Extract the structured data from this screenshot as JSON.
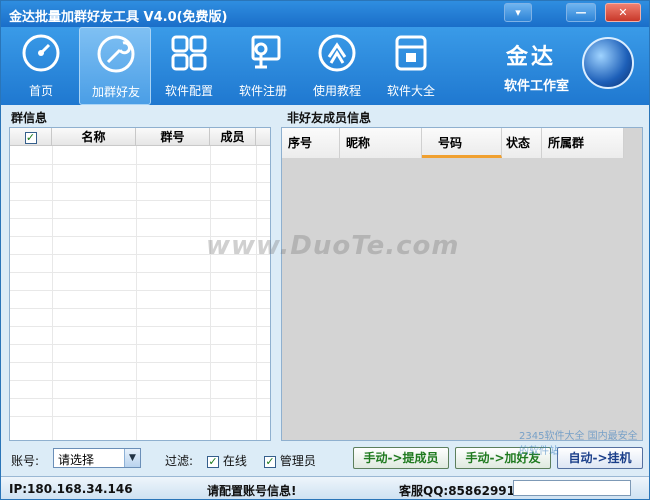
{
  "window": {
    "title": "金达批量加群好友工具 V4.0(免费版)",
    "controls": {
      "menu": "▾",
      "minimize": "—",
      "close": "✕"
    }
  },
  "toolbar": {
    "items": [
      {
        "label": "首页",
        "icon": "dashboard-icon"
      },
      {
        "label": "加群好友",
        "icon": "tools-icon",
        "active": true
      },
      {
        "label": "软件配置",
        "icon": "grid-icon"
      },
      {
        "label": "软件注册",
        "icon": "register-icon"
      },
      {
        "label": "使用教程",
        "icon": "tutorial-icon"
      },
      {
        "label": "软件大全",
        "icon": "box-icon"
      }
    ]
  },
  "brand": {
    "logo": "金达",
    "subtitle": "软件工作室"
  },
  "group_panel": {
    "title": "群信息",
    "columns": [
      "名称",
      "群号",
      "成员"
    ],
    "select_all_checked": true
  },
  "member_panel": {
    "title": "非好友成员信息",
    "columns": [
      "序号",
      "昵称",
      "号码",
      "状态",
      "所属群"
    ]
  },
  "watermark": "www.DuoTe.com",
  "bottom": {
    "account_label": "账号:",
    "account_select": "请选择",
    "filter_label": "过滤:",
    "filter_online": "在线",
    "filter_admin": "管理员",
    "btn_extract": "手动->提成员",
    "btn_add": "手动->加好友",
    "btn_auto": "自动->挂机"
  },
  "status": {
    "ip": "IP:180.168.34.146",
    "message": "请配置账号信息!",
    "support": "客服QQ:858629912"
  },
  "corner_mark": "2345软件大全 国内最安全的软件站"
}
